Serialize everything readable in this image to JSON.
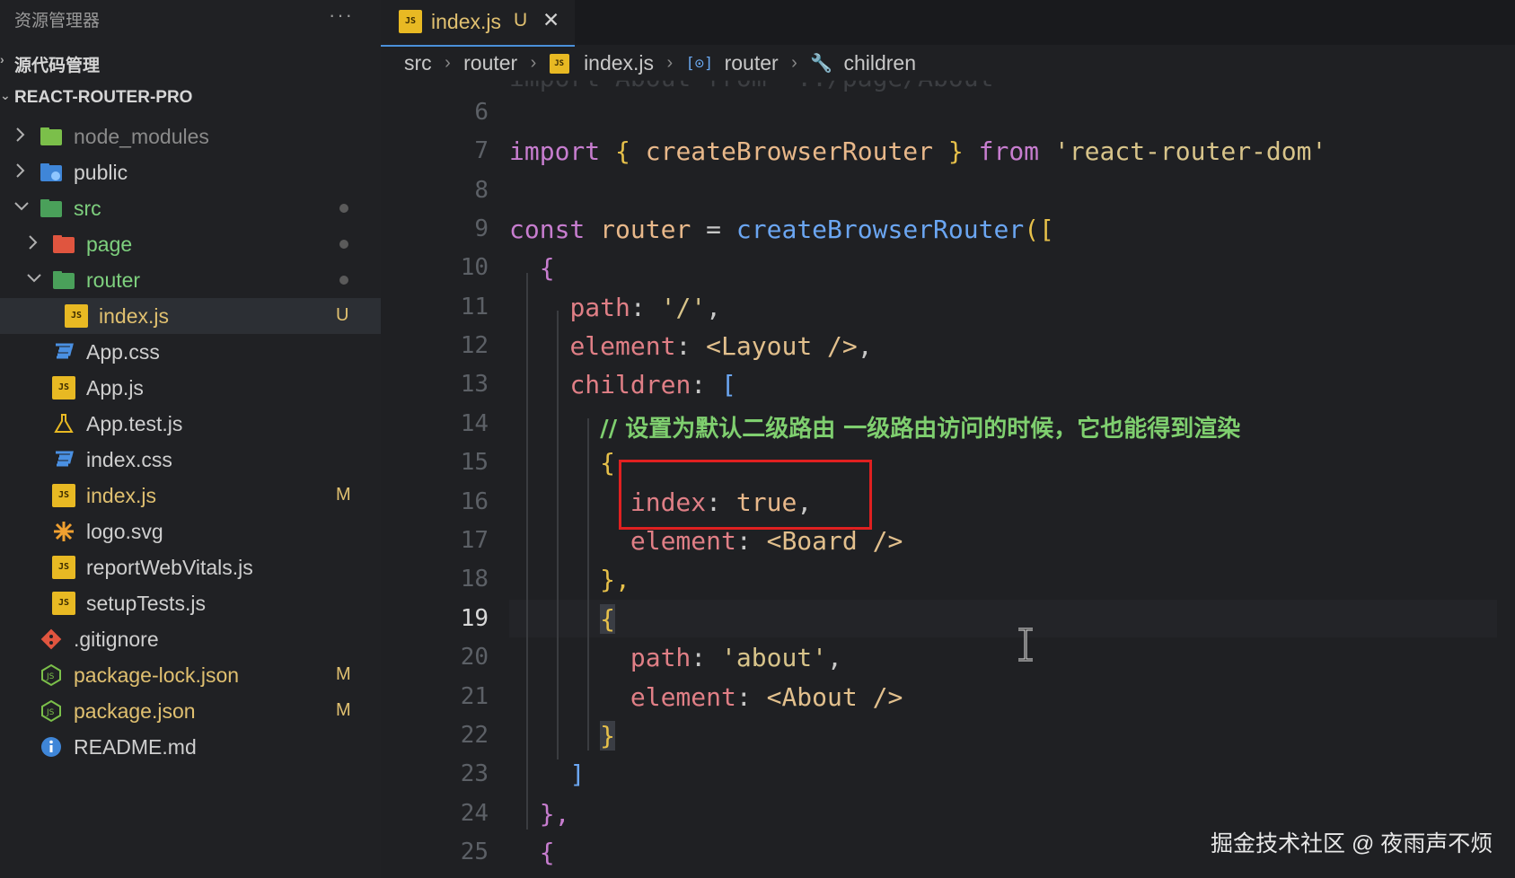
{
  "sidebar": {
    "title": "资源管理器",
    "more": "···",
    "source_control": "源代码管理",
    "project": "REACT-ROUTER-PRO",
    "items": [
      {
        "label": "node_modules",
        "badge": ""
      },
      {
        "label": "public",
        "badge": ""
      },
      {
        "label": "src",
        "badge": ""
      },
      {
        "label": "page",
        "badge": ""
      },
      {
        "label": "router",
        "badge": ""
      },
      {
        "label": "index.js",
        "badge": "U"
      },
      {
        "label": "App.css",
        "badge": ""
      },
      {
        "label": "App.js",
        "badge": ""
      },
      {
        "label": "App.test.js",
        "badge": ""
      },
      {
        "label": "index.css",
        "badge": ""
      },
      {
        "label": "index.js",
        "badge": "M"
      },
      {
        "label": "logo.svg",
        "badge": ""
      },
      {
        "label": "reportWebVitals.js",
        "badge": ""
      },
      {
        "label": "setupTests.js",
        "badge": ""
      },
      {
        "label": ".gitignore",
        "badge": ""
      },
      {
        "label": "package-lock.json",
        "badge": "M"
      },
      {
        "label": "package.json",
        "badge": "M"
      },
      {
        "label": "README.md",
        "badge": ""
      }
    ]
  },
  "tab": {
    "name": "index.js",
    "status": "U",
    "close": "✕",
    "js_icon": "JS"
  },
  "breadcrumb": [
    "src",
    "router",
    "index.js",
    "router",
    "children"
  ],
  "code": {
    "line_numbers": [
      "6",
      "7",
      "8",
      "9",
      "10",
      "11",
      "12",
      "13",
      "14",
      "15",
      "16",
      "17",
      "18",
      "19",
      "20",
      "21",
      "22",
      "23",
      "24",
      "25"
    ],
    "line5_fragment": "import About from '../page/About'",
    "l7": {
      "kw1": "import",
      "b1": "{",
      "fn": "createBrowserRouter",
      "b2": "}",
      "kw2": "from",
      "str": "'react-router-dom'"
    },
    "l9": {
      "kw": "const",
      "id": "router",
      "op": "=",
      "fn": "createBrowserRouter",
      "open": "(["
    },
    "l10": "{",
    "l11": {
      "prop": "path",
      "colon": ":",
      "str": "'/'",
      "comma": ","
    },
    "l12": {
      "prop": "element",
      "colon": ":",
      "tag": "<Layout />",
      "comma": ","
    },
    "l13": {
      "prop": "children",
      "colon": ":",
      "open": "["
    },
    "l14": "// 设置为默认二级路由 一级路由访问的时候，它也能得到渲染",
    "l15": "{",
    "l16": {
      "prop": "index",
      "colon": ":",
      "val": "true",
      "comma": ","
    },
    "l17": {
      "prop": "element",
      "colon": ":",
      "tag": "<Board />"
    },
    "l18": "},",
    "l19": "{",
    "l20": {
      "prop": "path",
      "colon": ":",
      "str": "'about'",
      "comma": ","
    },
    "l21": {
      "prop": "element",
      "colon": ":",
      "tag": "<About />"
    },
    "l22": "}",
    "l23": "]",
    "l24": "},",
    "l25": "{"
  },
  "watermark": "掘金技术社区 @ 夜雨声不烦",
  "colors": {
    "accent": "#4a90d9",
    "highlight": "#e02020",
    "keyword": "#c77dcf",
    "function": "#6ba6f2",
    "string": "#d8c48a",
    "property": "#e07f86",
    "comment": "#7fcf6f"
  }
}
